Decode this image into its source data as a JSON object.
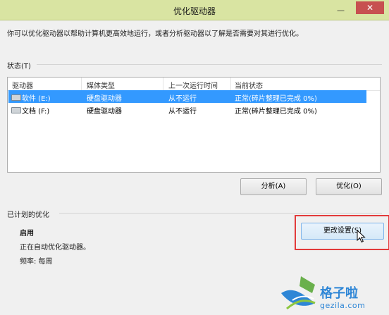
{
  "window": {
    "title": "优化驱动器",
    "minimize_glyph": "—",
    "close_glyph": "✕"
  },
  "description": "你可以优化驱动器以帮助计算机更高效地运行，或者分析驱动器以了解是否需要对其进行优化。",
  "status_section": {
    "label": "状态(T)",
    "columns": [
      "驱动器",
      "媒体类型",
      "上一次运行时间",
      "当前状态"
    ],
    "rows": [
      {
        "drive": "软件 (E:)",
        "media": "硬盘驱动器",
        "last_run": "从不运行",
        "status": "正常(碎片整理已完成 0%)",
        "selected": true
      },
      {
        "drive": "文档 (F:)",
        "media": "硬盘驱动器",
        "last_run": "从不运行",
        "status": "正常(碎片整理已完成 0%)",
        "selected": false
      }
    ],
    "analyze_button": "分析(A)",
    "optimize_button": "优化(O)"
  },
  "schedule_section": {
    "label": "已计划的优化",
    "state": "启用",
    "detail": "正在自动优化驱动器。",
    "frequency": "频率: 每周",
    "change_button": "更改设置(S)"
  },
  "watermark": {
    "text": "格子啦",
    "url": "gezila.com"
  },
  "colors": {
    "titlebar": "#d9e4a2",
    "selection": "#3399ff",
    "highlight_box": "#e23a3a",
    "close_button": "#c75050"
  }
}
